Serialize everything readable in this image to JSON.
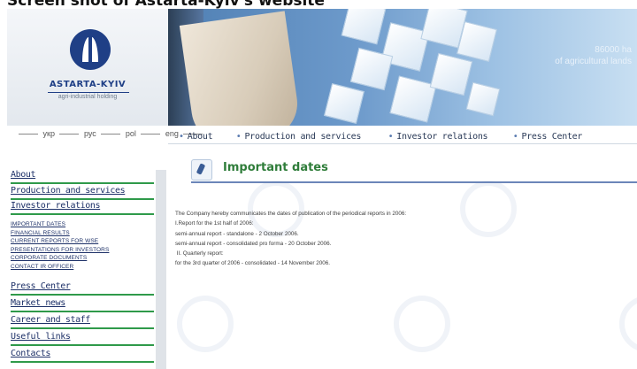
{
  "caption": "Screen shot of Astarta-Kyiv's website",
  "logo": {
    "name": "ASTARTA-KYIV",
    "tagline": "agri-industrial holding"
  },
  "banner": {
    "caption_line1": "86000 ha",
    "caption_line2": "of agricultural lands"
  },
  "languages": [
    "укр",
    "рус",
    "pol",
    "eng"
  ],
  "top_nav": [
    "About",
    "Production and services",
    "Investor relations",
    "Press Center"
  ],
  "sidebar": {
    "items_top": [
      "About",
      "Production and services",
      "Investor relations"
    ],
    "submenu": [
      "IMPORTANT DATES",
      "FINANCIAL RESULTS",
      "CURRENT REPORTS FOR WSE",
      "PRESENTATIONS FOR INVESTORS",
      "CORPORATE DOCUMENTS",
      "CONTACT IR OFFICER"
    ],
    "items_bottom": [
      "Press Center",
      "Market news",
      "Career and staff",
      "Useful links",
      "Contacts"
    ]
  },
  "page": {
    "title": "Important dates",
    "lines": [
      "The Company hereby communicates the dates of publication of the periodical reports in 2006:",
      "I.Report for the 1st half of 2006:",
      "semi-annual report - standalone - 2 October 2006.",
      "semi-annual report - consolidated pro forma - 20 October 2006.",
      " II. Quarterly report:",
      "for the 3rd quarter of 2006 - consolidated - 14 November 2006."
    ]
  },
  "colors": {
    "menu_underline": "#2f9a4a",
    "title_green": "#2f7d3a",
    "brand_blue": "#1f3f86"
  }
}
